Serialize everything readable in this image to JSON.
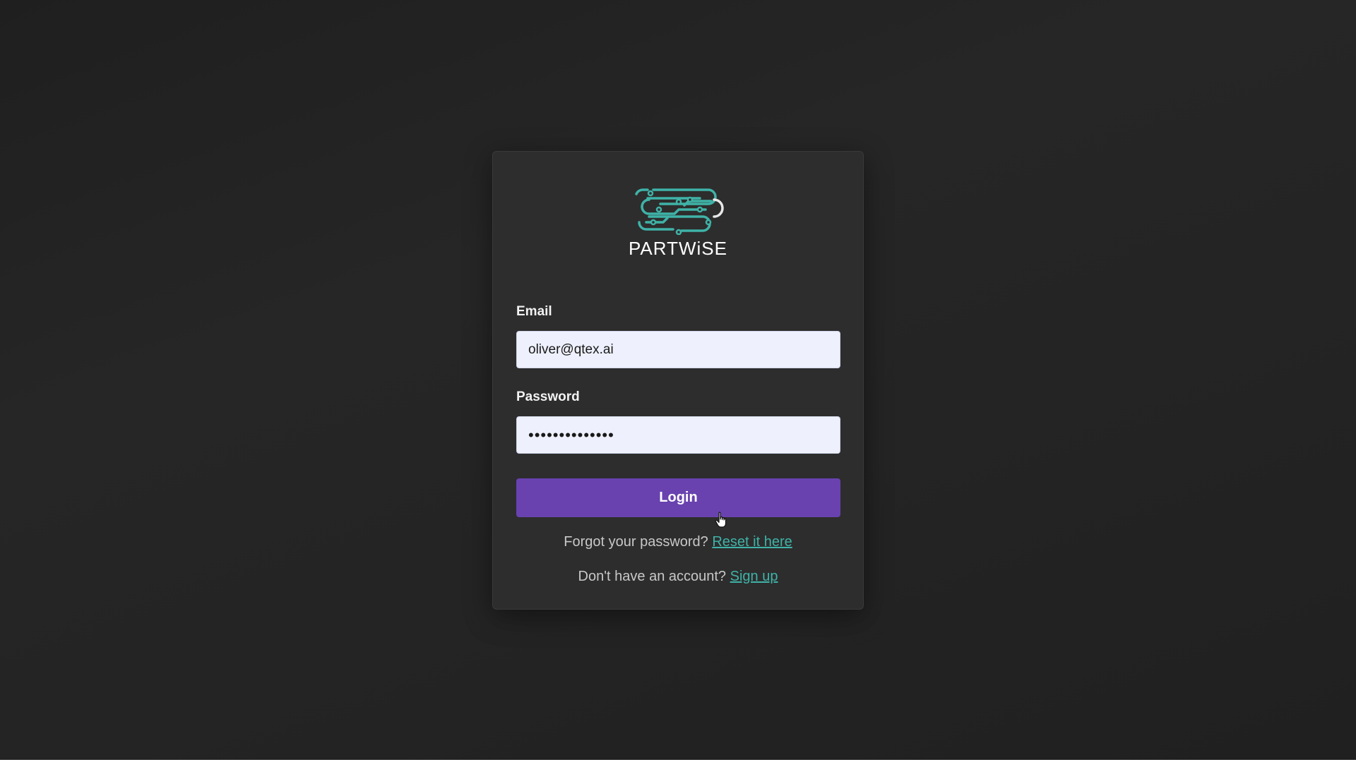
{
  "brand": {
    "name": "PARTWiSE",
    "logo_icon": "circuit-logo-icon",
    "logo_color": "#3fb3a8"
  },
  "form": {
    "email_label": "Email",
    "email_value": "oliver@qtex.ai",
    "password_label": "Password",
    "password_value": "••••••••••••••",
    "login_label": "Login"
  },
  "links": {
    "forgot_text": "Forgot your password?",
    "reset_label": "Reset it here",
    "signup_text": "Don't have an account?",
    "signup_label": "Sign up"
  },
  "colors": {
    "background": "#222222",
    "card": "#2d2d2d",
    "accent_button": "#6942b0",
    "link": "#3fb3a8",
    "input_background": "#eef1fd"
  },
  "cursor_icon": "hand-pointer-icon"
}
